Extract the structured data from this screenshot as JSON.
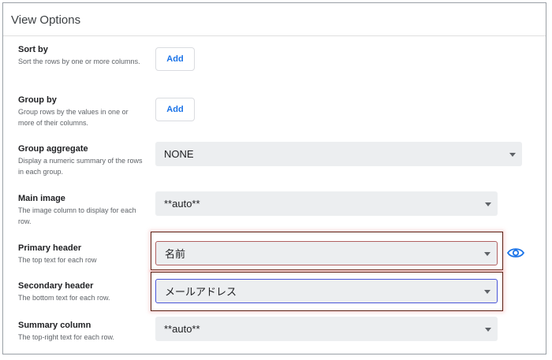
{
  "panel": {
    "title": "View Options"
  },
  "sort_by": {
    "label": "Sort by",
    "desc": "Sort the rows by one or more columns.",
    "button": "Add"
  },
  "group_by": {
    "label": "Group by",
    "desc": "Group rows by the values in one or more of their columns.",
    "button": "Add"
  },
  "group_aggregate": {
    "label": "Group aggregate",
    "desc": "Display a numeric summary of the rows in each group.",
    "value": "NONE"
  },
  "main_image": {
    "label": "Main image",
    "desc": "The image column to display for each row.",
    "value": "**auto**"
  },
  "primary_header": {
    "label": "Primary header",
    "desc": "The top text for each row",
    "value": "名前",
    "icon": "eye-icon"
  },
  "secondary_header": {
    "label": "Secondary header",
    "desc": "The bottom text for each row.",
    "value": "メールアドレス"
  },
  "summary_column": {
    "label": "Summary column",
    "desc": "The top-right text for each row.",
    "value": "**auto**"
  },
  "colors": {
    "accent": "#1a73e8",
    "highlight_border": "#5a1f12",
    "focus_border": "#4a55d8"
  }
}
